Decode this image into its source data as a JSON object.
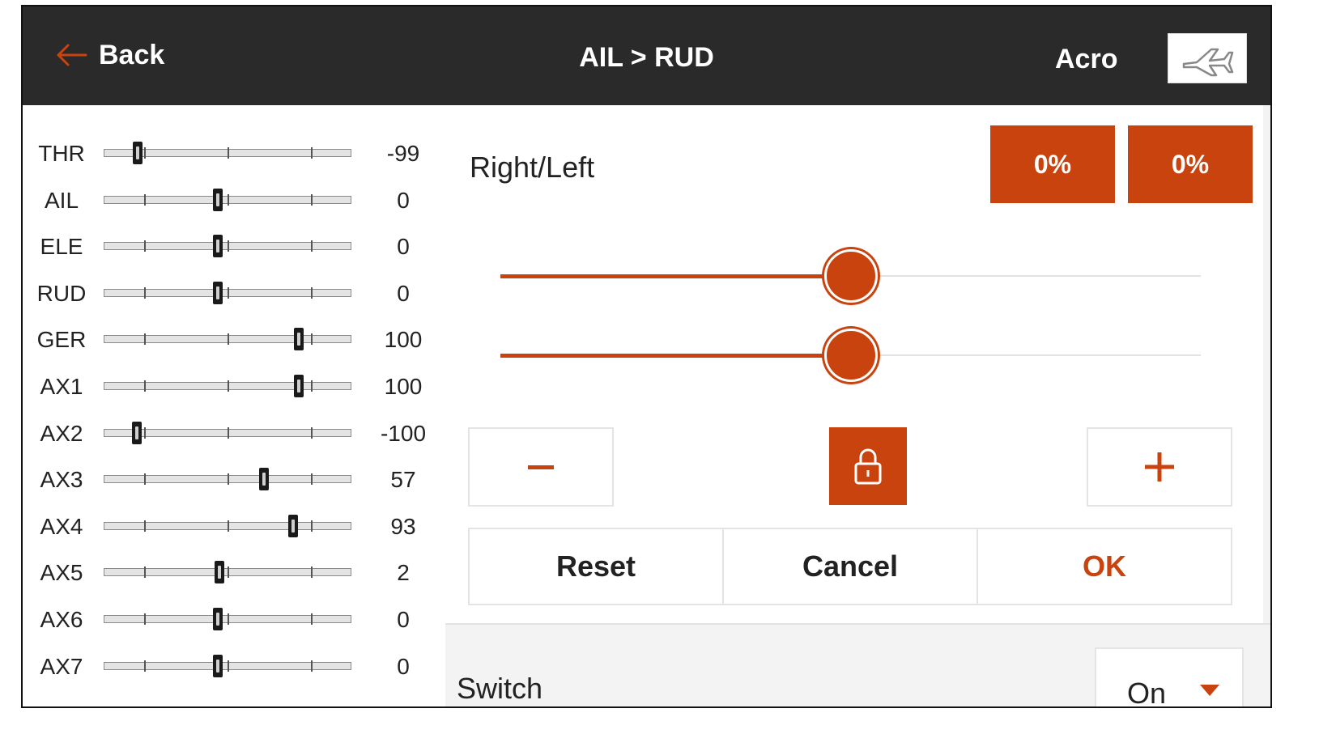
{
  "header": {
    "back_label": "Back",
    "title": "AIL > RUD",
    "mode": "Acro",
    "model_icon": "airplane-icon"
  },
  "monitor": {
    "channels": [
      {
        "name": "THR",
        "value": "-99",
        "position": -99
      },
      {
        "name": "AIL",
        "value": "0",
        "position": 0
      },
      {
        "name": "ELE",
        "value": "0",
        "position": 0
      },
      {
        "name": "RUD",
        "value": "0",
        "position": 0
      },
      {
        "name": "GER",
        "value": "100",
        "position": 100
      },
      {
        "name": "AX1",
        "value": "100",
        "position": 100
      },
      {
        "name": "AX2",
        "value": "-100",
        "position": -100
      },
      {
        "name": "AX3",
        "value": "57",
        "position": 57
      },
      {
        "name": "AX4",
        "value": "93",
        "position": 93
      },
      {
        "name": "AX5",
        "value": "2",
        "position": 2
      },
      {
        "name": "AX6",
        "value": "0",
        "position": 0
      },
      {
        "name": "AX7",
        "value": "0",
        "position": 0
      }
    ]
  },
  "editor": {
    "label": "Right/Left",
    "right_value": "0%",
    "left_value": "0%",
    "sliders": [
      {
        "name": "right",
        "fraction": 0.5
      },
      {
        "name": "left",
        "fraction": 0.5
      }
    ],
    "minus_label": "−",
    "plus_label": "+",
    "lock_icon": "lock-icon",
    "reset_label": "Reset",
    "cancel_label": "Cancel",
    "ok_label": "OK",
    "switch_label": "Switch",
    "switch_value": "On"
  },
  "colors": {
    "accent": "#c8430e",
    "header_bg": "#2a2a2a",
    "page_bg": "#f3f3f3"
  }
}
